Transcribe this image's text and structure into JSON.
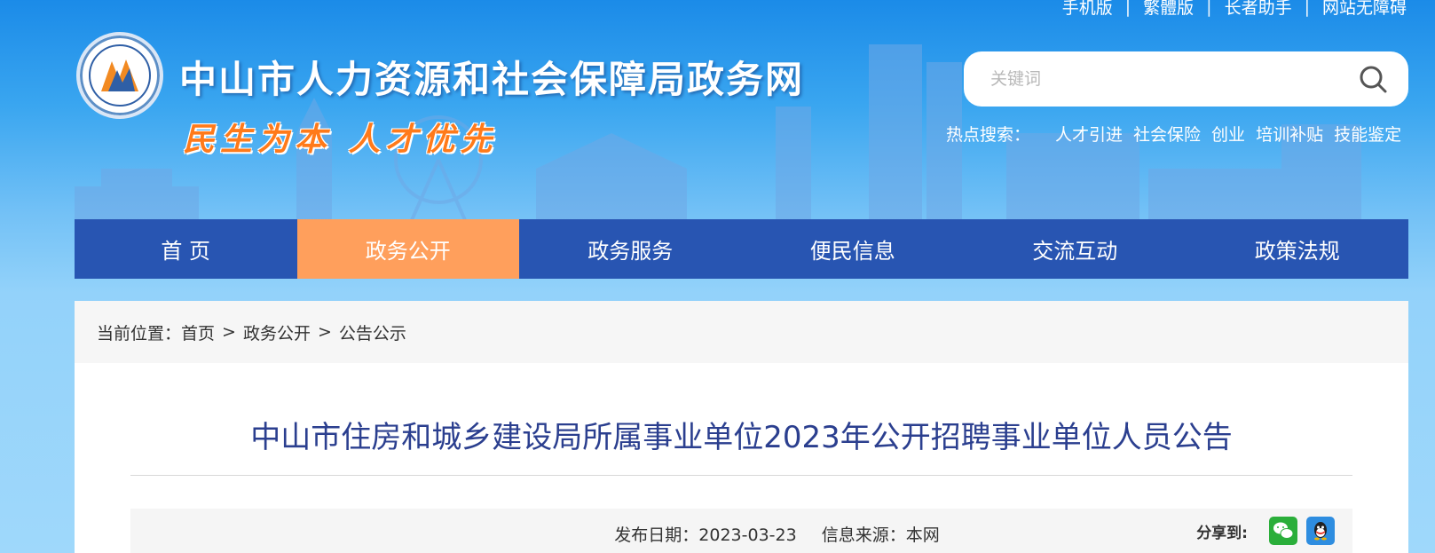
{
  "top_links": [
    "手机版",
    "繁體版",
    "长者助手",
    "网站无障碍"
  ],
  "site": {
    "title": "中山市人力资源和社会保障局政务网",
    "slogan": "民生为本 人才优先"
  },
  "search": {
    "placeholder": "关键词",
    "icon": "search-icon"
  },
  "hot_search": {
    "label": "热点搜索：",
    "items": [
      "人才引进",
      "社会保险",
      "创业",
      "培训补贴",
      "技能鉴定"
    ]
  },
  "nav": {
    "items": [
      "首 页",
      "政务公开",
      "政务服务",
      "便民信息",
      "交流互动",
      "政策法规"
    ],
    "active_index": 1
  },
  "breadcrumb": {
    "prefix": "当前位置：",
    "items": [
      "首页",
      "政务公开",
      "公告公示"
    ],
    "separator": ">"
  },
  "article": {
    "title": "中山市住房和城乡建设局所属事业单位2023年公开招聘事业单位人员公告",
    "publish_label": "发布日期：",
    "publish_date": "2023-03-23",
    "source_label": "信息来源：",
    "source": "本网",
    "share_label": "分享到:"
  },
  "colors": {
    "nav_bg": "#2855b2",
    "nav_active": "#ff9f5c",
    "title_color": "#2b3f8f",
    "slogan_color": "#ff7a1a"
  }
}
